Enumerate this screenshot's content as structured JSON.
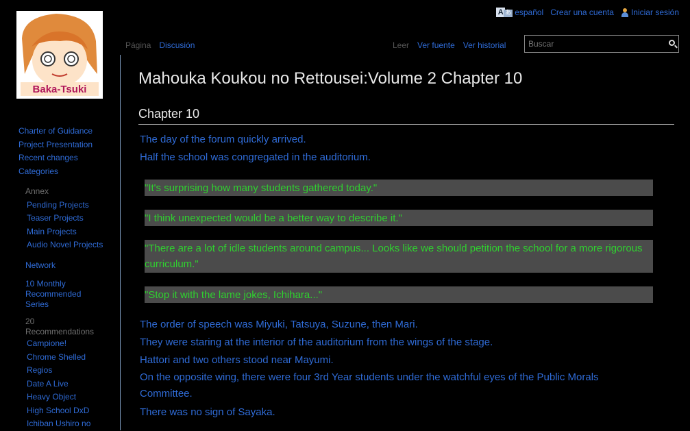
{
  "topbar": {
    "language": "español",
    "create_account": "Crear una cuenta",
    "login": "Iniciar sesión"
  },
  "logo": {
    "text": "Baka-Tsuki"
  },
  "tabs": {
    "page": "Página",
    "discussion": "Discusión",
    "read": "Leer",
    "view_source": "Ver fuente",
    "view_history": "Ver historial"
  },
  "search": {
    "placeholder": "Buscar"
  },
  "sidebar": {
    "nav": [
      "Charter of Guidance",
      "Project Presentation",
      "Recent changes",
      "Categories"
    ],
    "annex": {
      "heading": "Annex",
      "items": [
        "Pending Projects",
        "Teaser Projects",
        "Main Projects",
        "Audio Novel Projects"
      ]
    },
    "network": {
      "heading": "Network"
    },
    "monthly": {
      "heading": "10 Monthly Recommended Series"
    },
    "recommendations": {
      "heading": "20 Recommendations",
      "items": [
        "Campione!",
        "Chrome Shelled Regios",
        "Date A Live",
        "Heavy Object",
        "High School DxD",
        "Ichiban Ushiro no"
      ]
    }
  },
  "content": {
    "title": "Mahouka Koukou no Rettousei:Volume 2 Chapter 10",
    "section": "Chapter 10",
    "p1": "The day of the forum quickly arrived.",
    "p2": "Half the school was congregated in the auditorium.",
    "quotes": [
      "\"It's surprising how many students gathered today.\"",
      "\"I think unexpected would be a better way to describe it.\"",
      "\"There are a lot of idle students around campus... Looks like we should petition the school for a more rigorous curriculum.\"",
      "\"Stop it with the lame jokes, Ichihara...\""
    ],
    "p3": "The order of speech was Miyuki, Tatsuya, Suzune, then Mari.",
    "p4": "They were staring at the interior of the auditorium from the wings of the stage.",
    "p5": "Hattori and two others stood near Mayumi.",
    "p6": "On the opposite wing, there were four 3rd Year students under the watchful eyes of the Public Morals Committee.",
    "p7": "There was no sign of Sayaka."
  },
  "colors": {
    "link": "#2f6bd6",
    "quote_text": "#2fd12f",
    "quote_bg": "#4b4b4b",
    "background": "#000000"
  }
}
